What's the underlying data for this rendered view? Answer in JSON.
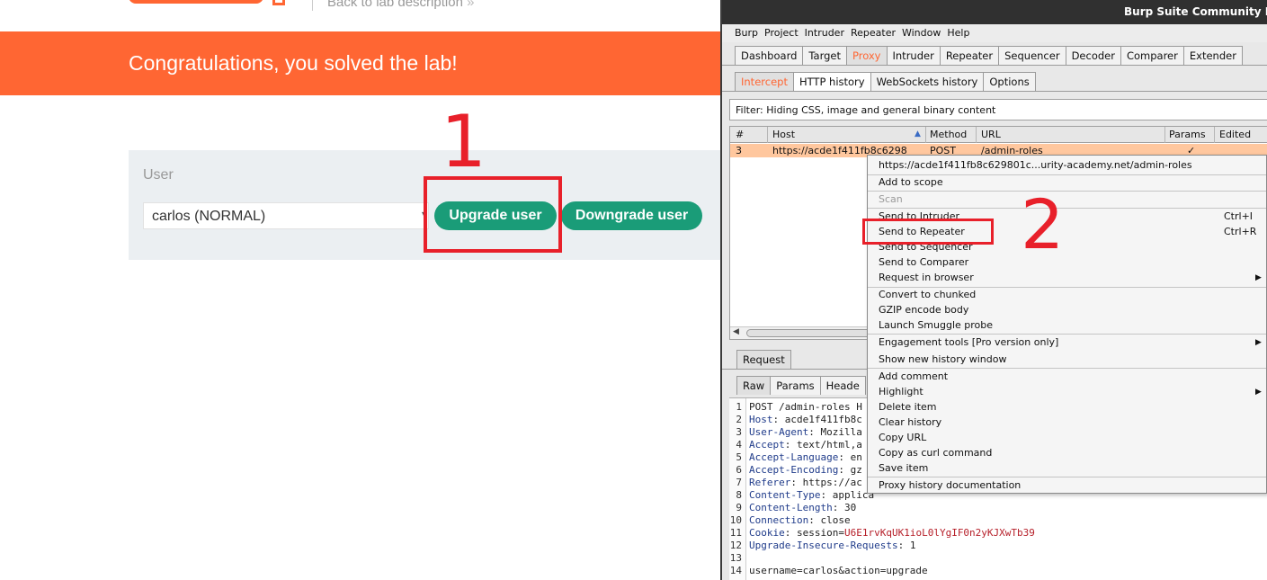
{
  "lab": {
    "back_link": "Back to lab description",
    "back_chevrons": "»",
    "congrats": "Congratulations, you solved the lab!",
    "user_label": "User",
    "user_select_value": "carlos (NORMAL)",
    "upgrade_button": "Upgrade user",
    "downgrade_button": "Downgrade user"
  },
  "annotations": {
    "one": "1",
    "two": "2"
  },
  "burp": {
    "title": "Burp Suite Community Edition",
    "menu": [
      "Burp",
      "Project",
      "Intruder",
      "Repeater",
      "Window",
      "Help"
    ],
    "main_tabs": [
      "Dashboard",
      "Target",
      "Proxy",
      "Intruder",
      "Repeater",
      "Sequencer",
      "Decoder",
      "Comparer",
      "Extender"
    ],
    "proxy_tabs": [
      "Intercept",
      "HTTP history",
      "WebSockets history",
      "Options"
    ],
    "filter": "Filter: Hiding CSS, image and general binary content",
    "columns": [
      "#",
      "Host",
      "Method",
      "URL",
      "Params",
      "Edited"
    ],
    "sort_indicator": "▲",
    "row": {
      "num": "3",
      "host": "https://acde1f411fb8c6298",
      "method": "POST",
      "url": "/admin-roles",
      "params": "✓"
    },
    "request_tab": "Request",
    "editor_tabs": [
      "Raw",
      "Params",
      "Heade"
    ],
    "request_lines": [
      {
        "n": "1",
        "k": "",
        "v": "POST /admin-roles H"
      },
      {
        "n": "2",
        "k": "Host",
        "v": ": acde1f411fb8c"
      },
      {
        "n": "3",
        "k": "User-Agent",
        "v": ": Mozilla"
      },
      {
        "n": "4",
        "k": "Accept",
        "v": ": text/html,a"
      },
      {
        "n": "5",
        "k": "Accept-Language",
        "v": ": en"
      },
      {
        "n": "6",
        "k": "Accept-Encoding",
        "v": ": gz"
      },
      {
        "n": "7",
        "k": "Referer",
        "v": ": https://ac"
      },
      {
        "n": "8",
        "k": "Content-Type",
        "v": ": applica"
      },
      {
        "n": "9",
        "k": "Content-Length",
        "v": ": 30"
      },
      {
        "n": "10",
        "k": "Connection",
        "v": ": close"
      },
      {
        "n": "11",
        "k": "Cookie",
        "v": ": session=",
        "v2": "U6E1rvKqUK1ioL0lYgIF0n2yKJXwTb39"
      },
      {
        "n": "12",
        "k": "Upgrade-Insecure-Requests",
        "v": ": 1"
      },
      {
        "n": "13",
        "k": "",
        "v": ""
      },
      {
        "n": "14",
        "k": "",
        "v": "username=carlos&action=upgrade"
      }
    ],
    "context_menu": {
      "url": "https://acde1f411fb8c629801c...urity-academy.net/admin-roles",
      "add_to_scope": "Add to scope",
      "scan": "Scan",
      "send_to_intruder": "Send to Intruder",
      "send_to_intruder_short": "Ctrl+I",
      "send_to_repeater": "Send to Repeater",
      "send_to_repeater_short": "Ctrl+R",
      "send_to_sequencer": "Send to Sequencer",
      "send_to_comparer": "Send to Comparer",
      "request_in_browser": "Request in browser",
      "convert_to_chunked": "Convert to chunked",
      "gzip_encode": "GZIP encode body",
      "launch_smuggle": "Launch Smuggle probe",
      "engagement_tools": "Engagement tools [Pro version only]",
      "show_new_history": "Show new history window",
      "add_comment": "Add comment",
      "highlight": "Highlight",
      "delete_item": "Delete item",
      "clear_history": "Clear history",
      "copy_url": "Copy URL",
      "copy_as_curl": "Copy as curl command",
      "save_item": "Save item",
      "proxy_docs": "Proxy history documentation",
      "submenu_arrow": "▶"
    }
  },
  "colors": {
    "accent": "#ff6633",
    "button_green": "#1a9c78",
    "annotation_red": "#e8202a",
    "row_highlight": "#ffc79e"
  }
}
